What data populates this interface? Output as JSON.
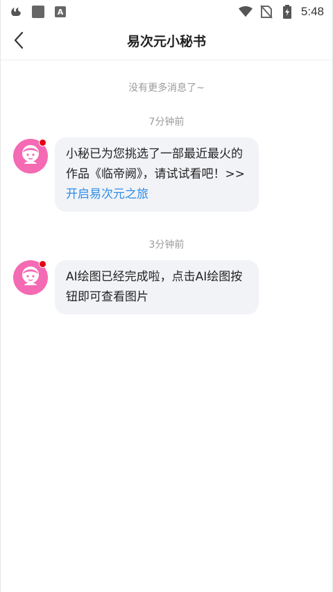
{
  "status_bar": {
    "time": "5:48",
    "icons": [
      "uc-browser-icon",
      "app-square-icon",
      "keyboard-a-icon",
      "wifi-icon",
      "no-sim-icon",
      "battery-charging-icon"
    ]
  },
  "header": {
    "title": "易次元小秘书",
    "back_icon": "chevron-left-icon"
  },
  "messages": {
    "no_more": "没有更多消息了~",
    "items": [
      {
        "time": "7分钟前",
        "text": "小秘已为您挑选了一部最近最火的作品《临帝阙》，请试试看吧！>>",
        "link": "开启易次元之旅"
      },
      {
        "time": "3分钟前",
        "text": "AI绘图已经完成啦，点击AI绘图按钮即可查看图片"
      }
    ]
  },
  "colors": {
    "avatar_bg": "#f46ab3",
    "bubble_bg": "#f2f3f7",
    "link": "#2c8de8",
    "unread_dot": "#e60012"
  }
}
